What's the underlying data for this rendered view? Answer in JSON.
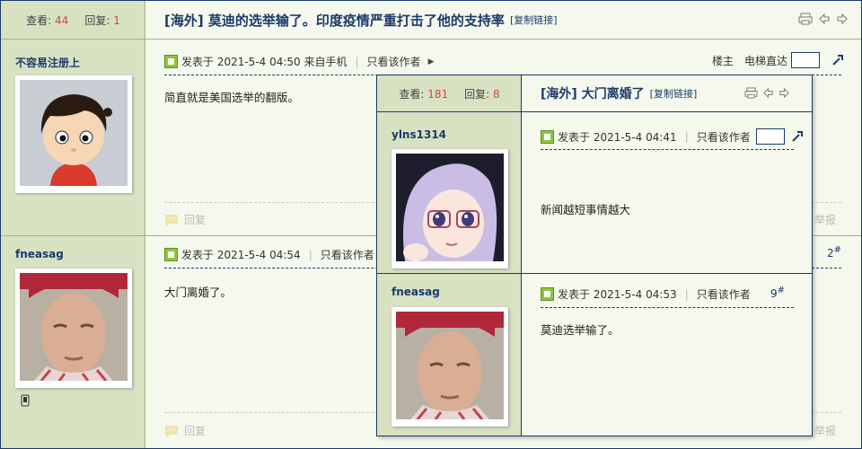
{
  "thread": {
    "views_label": "查看:",
    "views": "44",
    "replies_label": "回复:",
    "replies": "1",
    "title": "[海外] 莫迪的选举输了。印度疫情严重打击了他的支持率",
    "copy_link": "[复制链接]"
  },
  "posts": [
    {
      "author": "不容易注册上",
      "posted": "发表于 2021-5-4 04:50 来自手机",
      "only_author": "只看该作者",
      "content": "简直就是美国选举的翻版。",
      "floor_label": "楼主",
      "elevator": "电梯直达",
      "reply": "回复",
      "report": "举报"
    },
    {
      "author": "fneasag",
      "posted": "发表于 2021-5-4 04:54",
      "only_author": "只看该作者",
      "content": "大门离婚了。",
      "floor_num": "2",
      "floor_sup": "#",
      "reply": "回复",
      "report": "举报"
    }
  ],
  "popup": {
    "views_label": "查看:",
    "views": "181",
    "replies_label": "回复:",
    "replies": "8",
    "title": "[海外] 大门离婚了",
    "copy_link": "[复制链接]",
    "posts": [
      {
        "author": "ylns1314",
        "posted": "发表于 2021-5-4 04:41",
        "only_author": "只看该作者",
        "content": "新闻越短事情越大"
      },
      {
        "author": "fneasag",
        "posted": "发表于 2021-5-4 04:53",
        "only_author": "只看该作者",
        "content": "莫迪选举输了。",
        "floor_num": "9",
        "floor_sup": "#"
      }
    ]
  },
  "colors": {
    "accent": "#1b3a6b",
    "count": "#d04848",
    "sidebar": "#d8e2c3",
    "background": "#f5f8ec",
    "post_icon": "#8cc63f"
  }
}
